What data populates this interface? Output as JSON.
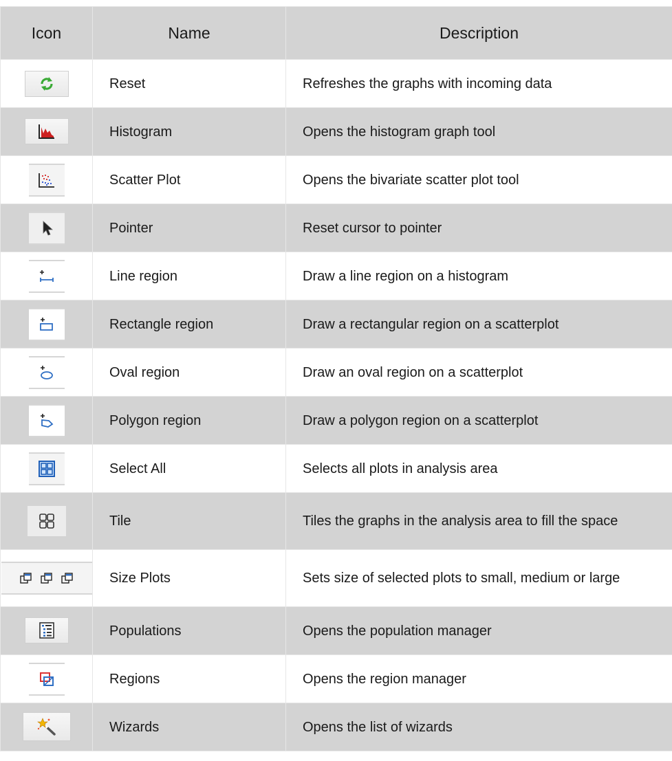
{
  "table": {
    "headers": {
      "icon": "Icon",
      "name": "Name",
      "description": "Description"
    },
    "rows": [
      {
        "icon": "reset-icon",
        "name": "Reset",
        "description": "Refreshes the graphs with incoming data"
      },
      {
        "icon": "histogram-icon",
        "name": "Histogram",
        "description": "Opens the histogram graph tool"
      },
      {
        "icon": "scatter-plot-icon",
        "name": "Scatter Plot",
        "description": "Opens the bivariate scatter plot tool"
      },
      {
        "icon": "pointer-icon",
        "name": "Pointer",
        "description": "Reset cursor to pointer"
      },
      {
        "icon": "line-region-icon",
        "name": "Line region",
        "description": "Draw a line region on a histogram"
      },
      {
        "icon": "rectangle-region-icon",
        "name": "Rectangle region",
        "description": "Draw a rectangular region on a scatterplot"
      },
      {
        "icon": "oval-region-icon",
        "name": "Oval region",
        "description": "Draw an oval region on a scatterplot"
      },
      {
        "icon": "polygon-region-icon",
        "name": "Polygon region",
        "description": "Draw a polygon region on a scatterplot"
      },
      {
        "icon": "select-all-icon",
        "name": "Select All",
        "description": "Selects all plots in analysis area"
      },
      {
        "icon": "tile-icon",
        "name": "Tile",
        "description": "Tiles the graphs in the analysis area to fill the space"
      },
      {
        "icon": "size-plots-icon",
        "name": "Size Plots",
        "description": "Sets size of selected plots to small, medium or large"
      },
      {
        "icon": "populations-icon",
        "name": "Populations",
        "description": "Opens the population manager"
      },
      {
        "icon": "regions-icon",
        "name": "Regions",
        "description": "Opens the region manager"
      },
      {
        "icon": "wizards-icon",
        "name": "Wizards",
        "description": "Opens the list of wizards"
      }
    ]
  },
  "colors": {
    "header_bg": "#d3d3d3",
    "row_alt_bg": "#d3d3d3",
    "row_bg": "#ffffff",
    "icon_blue": "#2f6fc4",
    "icon_red": "#cc2222",
    "icon_green": "#3aaa35"
  }
}
